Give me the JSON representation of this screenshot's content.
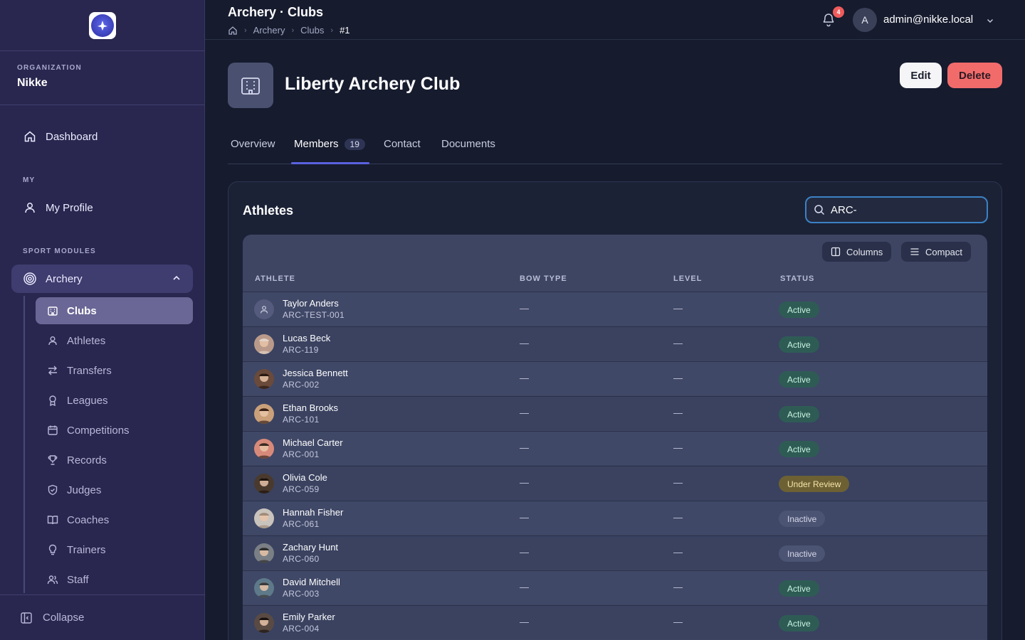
{
  "sidebar": {
    "org_label": "ORGANIZATION",
    "org_name": "Nikke",
    "dashboard": "Dashboard",
    "section_my": "MY",
    "my_profile": "My Profile",
    "section_sport": "SPORT MODULES",
    "archery": "Archery",
    "sub_items": [
      "Clubs",
      "Athletes",
      "Transfers",
      "Leagues",
      "Competitions",
      "Records",
      "Judges",
      "Coaches",
      "Trainers",
      "Staff"
    ],
    "collapse": "Collapse"
  },
  "topbar": {
    "title": "Archery · Clubs",
    "breadcrumbs": [
      "Archery",
      "Clubs",
      "#1"
    ],
    "notifications": "4",
    "avatar_initial": "A",
    "user": "admin@nikke.local"
  },
  "header": {
    "club_name": "Liberty Archery Club",
    "edit": "Edit",
    "delete": "Delete"
  },
  "tabs": [
    {
      "label": "Overview"
    },
    {
      "label": "Members",
      "count": "19"
    },
    {
      "label": "Contact"
    },
    {
      "label": "Documents"
    }
  ],
  "panel": {
    "title": "Athletes",
    "search_value": "ARC-",
    "columns_btn": "Columns",
    "compact_btn": "Compact",
    "headers": [
      "ATHLETE",
      "BOW TYPE",
      "LEVEL",
      "STATUS"
    ],
    "rows": [
      {
        "name": "Taylor Anders",
        "code": "ARC-TEST-001",
        "bow": "—",
        "level": "—",
        "status": "Active",
        "kind": "active"
      },
      {
        "name": "Lucas Beck",
        "code": "ARC-119",
        "bow": "—",
        "level": "—",
        "status": "Active",
        "kind": "active"
      },
      {
        "name": "Jessica Bennett",
        "code": "ARC-002",
        "bow": "—",
        "level": "—",
        "status": "Active",
        "kind": "active"
      },
      {
        "name": "Ethan Brooks",
        "code": "ARC-101",
        "bow": "—",
        "level": "—",
        "status": "Active",
        "kind": "active"
      },
      {
        "name": "Michael Carter",
        "code": "ARC-001",
        "bow": "—",
        "level": "—",
        "status": "Active",
        "kind": "active"
      },
      {
        "name": "Olivia Cole",
        "code": "ARC-059",
        "bow": "—",
        "level": "—",
        "status": "Under Review",
        "kind": "review"
      },
      {
        "name": "Hannah Fisher",
        "code": "ARC-061",
        "bow": "—",
        "level": "—",
        "status": "Inactive",
        "kind": "inactive"
      },
      {
        "name": "Zachary Hunt",
        "code": "ARC-060",
        "bow": "—",
        "level": "—",
        "status": "Inactive",
        "kind": "inactive"
      },
      {
        "name": "David Mitchell",
        "code": "ARC-003",
        "bow": "—",
        "level": "—",
        "status": "Active",
        "kind": "active"
      },
      {
        "name": "Emily Parker",
        "code": "ARC-004",
        "bow": "—",
        "level": "—",
        "status": "Active",
        "kind": "active"
      }
    ]
  },
  "colors": {
    "accent": "#5a63e0",
    "delete": "#f26b6b",
    "sidebar_bg": "#29274f",
    "status_active": "#2e5c55",
    "status_review": "#6d6134",
    "status_inactive": "#4c5474"
  }
}
